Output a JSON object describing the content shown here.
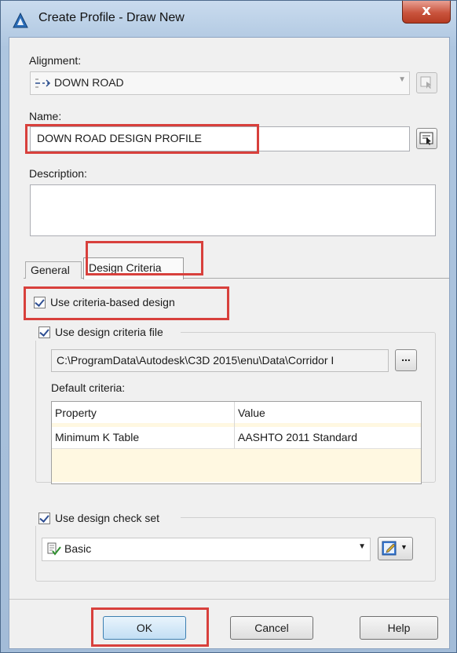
{
  "window": {
    "title": "Create Profile - Draw New",
    "close_label": "x"
  },
  "alignment": {
    "label": "Alignment:",
    "value": "DOWN ROAD"
  },
  "name": {
    "label": "Name:",
    "value": "DOWN ROAD DESIGN PROFILE"
  },
  "description": {
    "label": "Description:",
    "value": ""
  },
  "tabs": [
    {
      "label": "General"
    },
    {
      "label": "Design Criteria"
    }
  ],
  "design_criteria": {
    "use_criteria_based_design": {
      "label": "Use criteria-based design",
      "checked": true
    },
    "use_design_criteria_file": {
      "label": "Use design criteria file",
      "checked": true
    },
    "file_path": "C:\\ProgramData\\Autodesk\\C3D 2015\\enu\\Data\\Corridor I",
    "browse_label": "...",
    "default_criteria_label": "Default criteria:",
    "table": {
      "headers": [
        "Property",
        "Value"
      ],
      "rows": [
        [
          "Minimum K Table",
          "AASHTO 2011 Standard"
        ]
      ]
    },
    "use_design_check_set": {
      "label": "Use design check set",
      "checked": true
    },
    "check_set_value": "Basic"
  },
  "buttons": {
    "ok": "OK",
    "cancel": "Cancel",
    "help": "Help"
  },
  "colors": {
    "highlight": "#d8403c",
    "title_bar": "#aec6e0"
  }
}
